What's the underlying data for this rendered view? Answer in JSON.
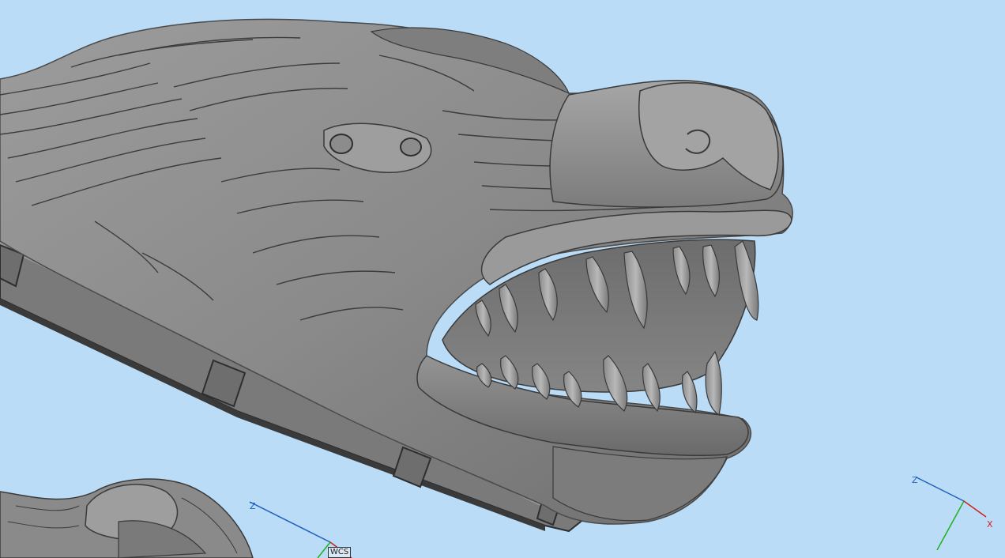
{
  "viewport": {
    "background": "#badcf7",
    "model": {
      "subject": "wolf-head-sculpture",
      "surface_color": "#8e8e8e",
      "shadow_color": "#3a3a3a",
      "highlight_color": "#bdbdbd"
    }
  },
  "wcs_gizmo": {
    "z_label": "Z",
    "badge_label": "WCS",
    "z_color": "#2060c0",
    "y_color": "#20b020",
    "x_color": "#d02020"
  },
  "view_gizmo": {
    "z_label": "Z",
    "x_label": "X",
    "z_color": "#2060c0",
    "y_color": "#20b020",
    "x_color": "#d02020"
  }
}
